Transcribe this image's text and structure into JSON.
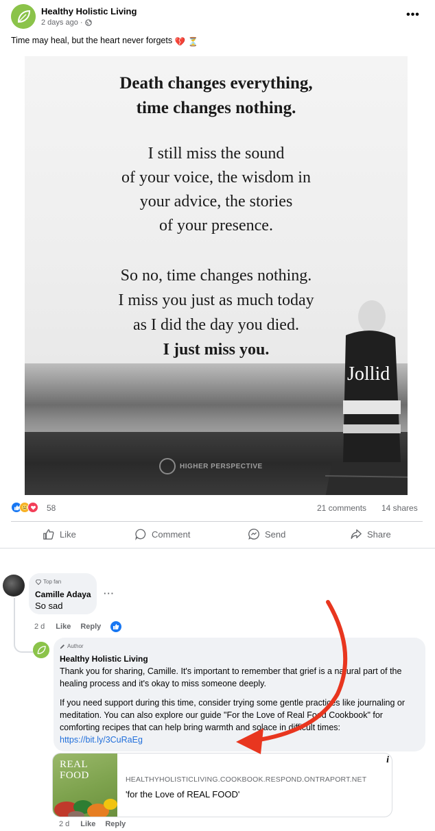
{
  "post": {
    "page_name": "Healthy Holistic Living",
    "timestamp": "2 days ago · ",
    "caption": "Time may heal, but the heart never forgets",
    "caption_emojis": [
      "💔",
      "⏳"
    ],
    "image": {
      "line1": "Death changes everything,",
      "line2": "time changes nothing.",
      "para2": [
        "I still miss the sound",
        "of your voice, the wisdom in",
        "your advice, the stories",
        "of your presence."
      ],
      "para3": [
        "So no, time changes nothing.",
        "I miss you just as much today",
        "as I did the day you died."
      ],
      "closing": "I just miss you.",
      "jacket_text": "Jollid",
      "watermark": "HIGHER PERSPECTIVE"
    },
    "reactions_count": "58",
    "comments_count": "21 comments",
    "shares_count": "14 shares",
    "actions": {
      "like": "Like",
      "comment": "Comment",
      "send": "Send",
      "share": "Share"
    }
  },
  "comments": {
    "camille": {
      "badge": "Top fan",
      "name": "Camille Adaya",
      "text": "So sad",
      "time": "2 d",
      "like": "Like",
      "reply": "Reply"
    },
    "author_reply": {
      "badge": "Author",
      "name": "Healthy Holistic Living",
      "para1": "Thank you for sharing, Camille. It's important to remember that grief is a natural part of the healing process and it's okay to miss someone deeply.",
      "para2_text": "If you need support during this time, consider trying some gentle practices like journaling or meditation. You can also explore our guide \"For the Love of Real Food Cookbook\" for comforting recipes that can help bring warmth and solace in difficult times: ",
      "link": "https://bit.ly/3CuRaEg",
      "time": "2 d",
      "like": "Like",
      "reply": "Reply"
    },
    "link_preview": {
      "thumb_title_line1": "REAL",
      "thumb_title_line2": "FOOD",
      "domain": "HEALTHYHOLISTICLIVING.COOKBOOK.RESPOND.ONTRAPORT.NET",
      "title": "'for the Love of REAL FOOD'",
      "info": "i"
    }
  },
  "colors": {
    "brand_green": "#8bc34a",
    "link_blue": "#216fdb",
    "like_blue": "#1877f2",
    "annotation_red": "#e8361f"
  }
}
